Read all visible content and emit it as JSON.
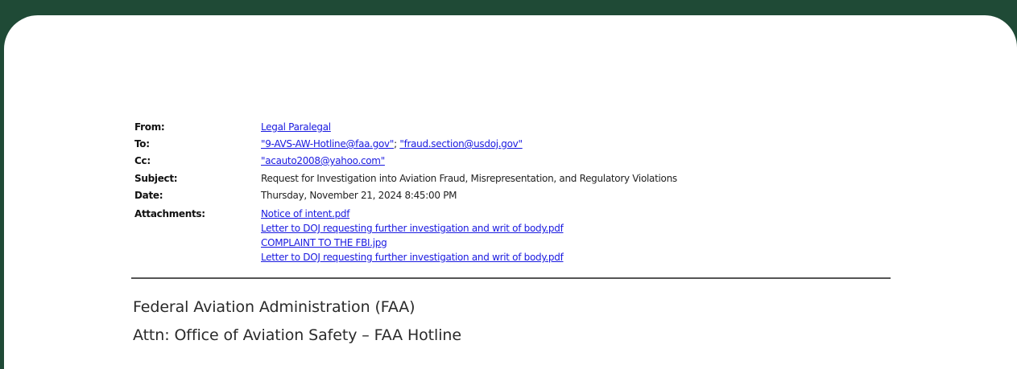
{
  "email": {
    "from_label": "From:",
    "from_value": "Legal Paralegal",
    "to_label": "To:",
    "to_values": [
      "\"9-AVS-AW-Hotline@faa.gov\"",
      "\"fraud.section@usdoj.gov\""
    ],
    "to_separator": "; ",
    "cc_label": "Cc:",
    "cc_value": "\"acauto2008@yahoo.com\"",
    "subject_label": "Subject:",
    "subject_value": "Request for Investigation into Aviation Fraud, Misrepresentation, and Regulatory Violations",
    "date_label": "Date:",
    "date_value": "Thursday, November 21, 2024 8:45:00 PM",
    "attachments_label": "Attachments:",
    "attachments": [
      "Notice of intent.pdf",
      "Letter to DOJ requesting further investigation and writ of body.pdf",
      "COMPLAINT TO THE FBI.jpg",
      "Letter to DOJ requesting further investigation and writ of body.pdf"
    ]
  },
  "body": {
    "line1": "Federal Aviation Administration (FAA)",
    "line2": "Attn: Office of Aviation Safety – FAA Hotline"
  }
}
